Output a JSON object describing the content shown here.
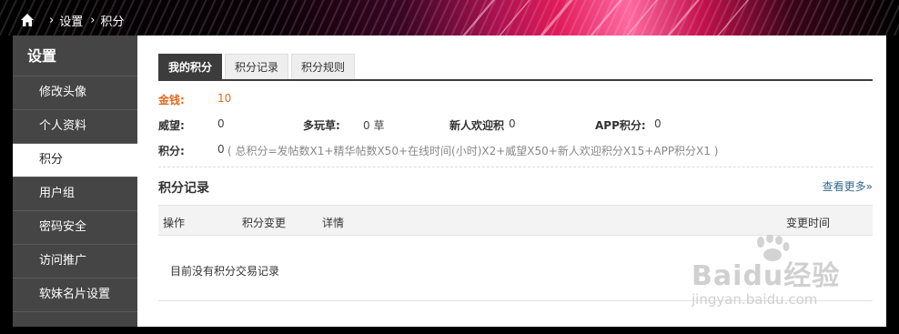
{
  "breadcrumb": {
    "home_icon": "home-icon",
    "separator": "›",
    "items": [
      "设置",
      "积分"
    ]
  },
  "sidebar": {
    "title": "设置",
    "items": [
      {
        "label": "修改头像"
      },
      {
        "label": "个人资料"
      },
      {
        "label": "积分",
        "active": true
      },
      {
        "label": "用户组"
      },
      {
        "label": "密码安全"
      },
      {
        "label": "访问推广"
      },
      {
        "label": "软妹名片设置"
      }
    ]
  },
  "tabs": [
    {
      "label": "我的积分",
      "active": true
    },
    {
      "label": "积分记录"
    },
    {
      "label": "积分规则"
    }
  ],
  "stats": {
    "gold_label": "金钱:",
    "gold_value": "10",
    "prestige_label": "威望:",
    "prestige_value": "0",
    "grass_label": "多玩草:",
    "grass_value": "0 草",
    "welcome_label": "新人欢迎积",
    "welcome_value": "0",
    "app_label": "APP积分:",
    "app_value": "0",
    "points_label": "积分:",
    "points_value": "0",
    "points_formula": "( 总积分=发帖数X1+精华帖数X50+在线时间(小时)X2+威望X50+新人欢迎积分X15+APP积分X1 )"
  },
  "records": {
    "title": "积分记录",
    "more_link": "查看更多»",
    "columns": [
      "操作",
      "积分变更",
      "详情",
      "变更时间"
    ],
    "empty_text": "目前没有积分交易记录"
  },
  "watermark": {
    "brand": "Baidu经验",
    "site": "jingyan.baidu.com"
  },
  "colors": {
    "accent_gold": "#e06a1c",
    "link": "#33698b",
    "sidebar_bg": "#454545",
    "tab_active_bg": "#3c3c3c"
  }
}
